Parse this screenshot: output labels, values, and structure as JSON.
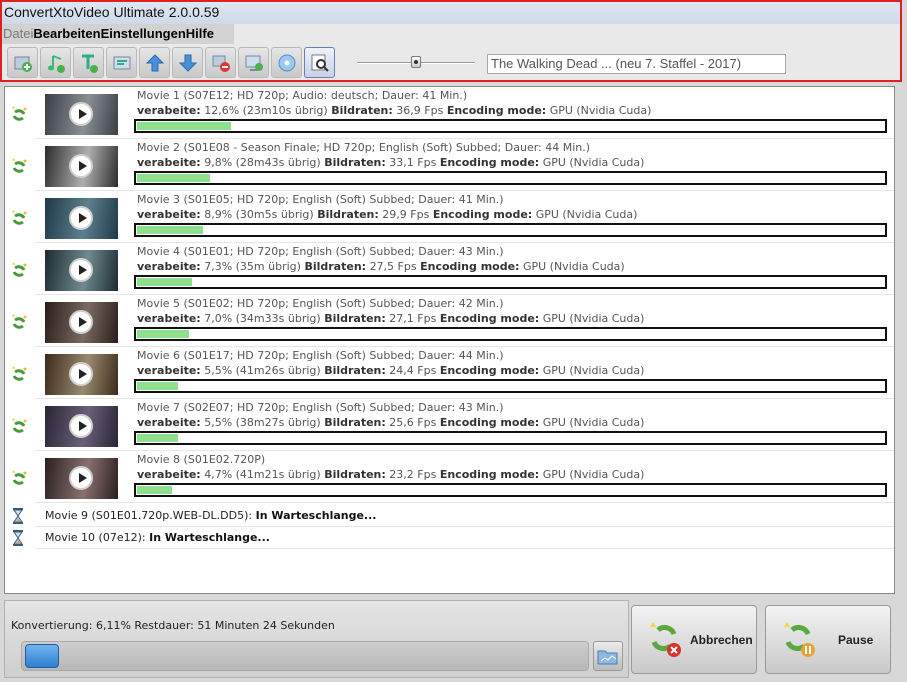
{
  "window": {
    "title": "ConvertXtoVideo Ultimate 2.0.0.59"
  },
  "menu": [
    {
      "label": "Datei",
      "dim": true
    },
    {
      "label": "Bearbeiten",
      "dim": false
    },
    {
      "label": "Einstellungen",
      "dim": false
    },
    {
      "label": "Hilfe",
      "dim": false
    }
  ],
  "toolbar": {
    "buttons": [
      {
        "name": "add-video-button",
        "icon": "add-video-icon"
      },
      {
        "name": "audio-button",
        "icon": "audio-track-icon"
      },
      {
        "name": "subtitle-button",
        "icon": "subtitle-icon"
      },
      {
        "name": "chapters-button",
        "icon": "chapters-icon"
      },
      {
        "name": "move-up-button",
        "icon": "arrow-up-icon"
      },
      {
        "name": "move-down-button",
        "icon": "arrow-down-icon"
      },
      {
        "name": "remove-button",
        "icon": "remove-icon"
      },
      {
        "name": "convert-button",
        "icon": "convert-icon"
      },
      {
        "name": "burn-button",
        "icon": "disc-icon"
      },
      {
        "name": "preview-button",
        "icon": "magnifier-icon"
      }
    ],
    "title_field_value": "The Walking Dead ... (neu 7. Staffel - 2017)",
    "zoom_slider_level": 0.5
  },
  "labels": {
    "processed": "verabeite:",
    "framerate": "Bildraten:",
    "encoding": "Encoding mode:",
    "queued": "In Warteschlange..."
  },
  "movies": [
    {
      "info": "Movie 1 (S07E12; HD 720p; Audio: deutsch; Dauer: 41 Min.)",
      "progress": "12,6% (23m10s übrig)",
      "fps": "36,9 Fps",
      "mode": "GPU (Nvidia Cuda)",
      "fill": 0.126
    },
    {
      "info": "Movie 2 (S01E08 - Season Finale; HD 720p; English (Soft) Subbed; Dauer: 44 Min.)",
      "progress": "9,8% (28m43s übrig)",
      "fps": "33,1 Fps",
      "mode": "GPU (Nvidia Cuda)",
      "fill": 0.098
    },
    {
      "info": "Movie 3 (S01E05; HD 720p; English (Soft) Subbed; Dauer: 41 Min.)",
      "progress": "8,9% (30m5s übrig)",
      "fps": "29,9 Fps",
      "mode": "GPU (Nvidia Cuda)",
      "fill": 0.089
    },
    {
      "info": "Movie 4 (S01E01; HD 720p; English (Soft) Subbed; Dauer: 43 Min.)",
      "progress": "7,3% (35m übrig)",
      "fps": "27,5 Fps",
      "mode": "GPU (Nvidia Cuda)",
      "fill": 0.073
    },
    {
      "info": "Movie 5 (S01E02; HD 720p; English (Soft) Subbed; Dauer: 42 Min.)",
      "progress": "7,0% (34m33s übrig)",
      "fps": "27,1 Fps",
      "mode": "GPU (Nvidia Cuda)",
      "fill": 0.07
    },
    {
      "info": "Movie 6 (S01E17; HD 720p; English (Soft) Subbed; Dauer: 44 Min.)",
      "progress": "5,5% (41m26s übrig)",
      "fps": "24,4 Fps",
      "mode": "GPU (Nvidia Cuda)",
      "fill": 0.055
    },
    {
      "info": "Movie 7 (S02E07; HD 720p; English (Soft) Subbed; Dauer: 43 Min.)",
      "progress": "5,5% (38m27s übrig)",
      "fps": "25,6 Fps",
      "mode": "GPU (Nvidia Cuda)",
      "fill": 0.055
    },
    {
      "info": "Movie 8 (S01E02.720P)",
      "progress": "4,7% (41m21s übrig)",
      "fps": "23,2 Fps",
      "mode": "GPU (Nvidia Cuda)",
      "fill": 0.047
    }
  ],
  "queued": [
    {
      "info": "Movie 9 (S01E01.720p.WEB-DL.DD5):"
    },
    {
      "info": "Movie 10 (07e12):"
    }
  ],
  "status": {
    "text": "Konvertierung: 6,11% Restdauer: 51 Minuten 24 Sekunden",
    "overall_fill": 0.0611
  },
  "buttons": {
    "cancel": "Abbrechen",
    "pause": "Pause"
  },
  "colors": {
    "progress_fill": "#8ee08e",
    "frame_border": "#e02020",
    "overall_fill": "#2c7fd0"
  }
}
